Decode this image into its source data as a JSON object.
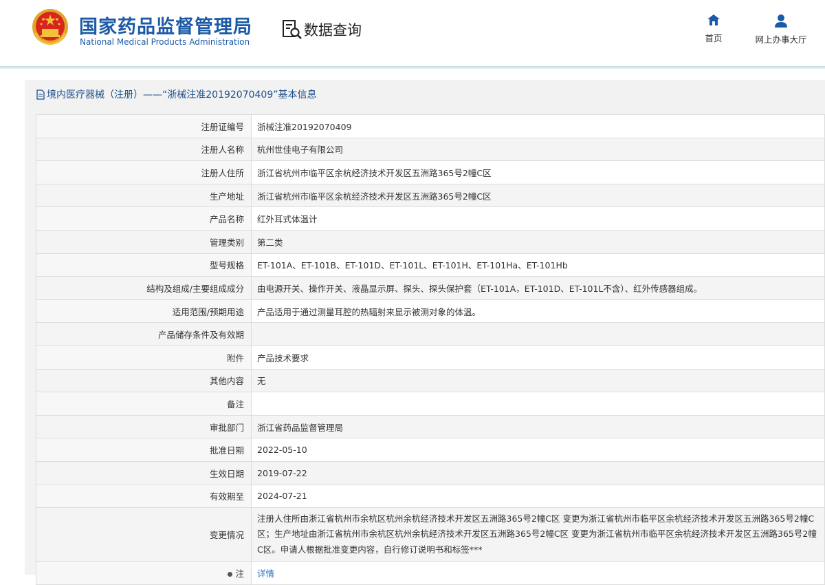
{
  "header": {
    "brand_cn": "国家药品监督管理局",
    "brand_en": "National Medical Products Administration",
    "logo_icon": "national-emblem-icon",
    "query_label": "数据查询",
    "query_icon": "document-search-icon",
    "nav": [
      {
        "label": "首页",
        "icon": "home-icon"
      },
      {
        "label": "网上办事大厅",
        "icon": "user-icon"
      }
    ]
  },
  "panel": {
    "title": "境内医疗器械（注册）——“浙械注准20192070409”基本信息",
    "title_icon": "document-icon"
  },
  "rows": [
    {
      "key": "注册证编号",
      "value": "浙械注准20192070409"
    },
    {
      "key": "注册人名称",
      "value": "杭州世佳电子有限公司"
    },
    {
      "key": "注册人住所",
      "value": "浙江省杭州市临平区余杭经济技术开发区五洲路365号2幢C区"
    },
    {
      "key": "生产地址",
      "value": "浙江省杭州市临平区余杭经济技术开发区五洲路365号2幢C区"
    },
    {
      "key": "产品名称",
      "value": "红外耳式体温计"
    },
    {
      "key": "管理类别",
      "value": "第二类"
    },
    {
      "key": "型号规格",
      "value": "ET-101A、ET-101B、ET-101D、ET-101L、ET-101H、ET-101Ha、ET-101Hb"
    },
    {
      "key": "结构及组成/主要组成成分",
      "value": "由电源开关、操作开关、液晶显示屏、探头、探头保护套（ET-101A，ET-101D、ET-101L不含）、红外传感器组成。"
    },
    {
      "key": "适用范围/预期用途",
      "value": "产品适用于通过测量耳腔的热辐射来显示被测对象的体温。"
    },
    {
      "key": "产品储存条件及有效期",
      "value": ""
    },
    {
      "key": "附件",
      "value": "产品技术要求"
    },
    {
      "key": "其他内容",
      "value": "无"
    },
    {
      "key": "备注",
      "value": ""
    },
    {
      "key": "审批部门",
      "value": "浙江省药品监督管理局"
    },
    {
      "key": "批准日期",
      "value": "2022-05-10"
    },
    {
      "key": "生效日期",
      "value": "2019-07-22"
    },
    {
      "key": "有效期至",
      "value": "2024-07-21"
    },
    {
      "key": "变更情况",
      "value": "注册人住所由浙江省杭州市余杭区杭州余杭经济技术开发区五洲路365号2幢C区 变更为浙江省杭州市临平区余杭经济技术开发区五洲路365号2幢C区；生产地址由浙江省杭州市余杭区杭州余杭经济技术开发区五洲路365号2幢C区 变更为浙江省杭州市临平区余杭经济技术开发区五洲路365号2幢C区。申请人根据批准变更内容，自行修订说明书和标签***"
    },
    {
      "key": "注",
      "value": "详情"
    }
  ],
  "colors": {
    "brand_blue": "#1c5aa8",
    "link_blue": "#2a6fc9",
    "emblem_red": "#d7261e",
    "emblem_gold": "#f2c33a"
  }
}
